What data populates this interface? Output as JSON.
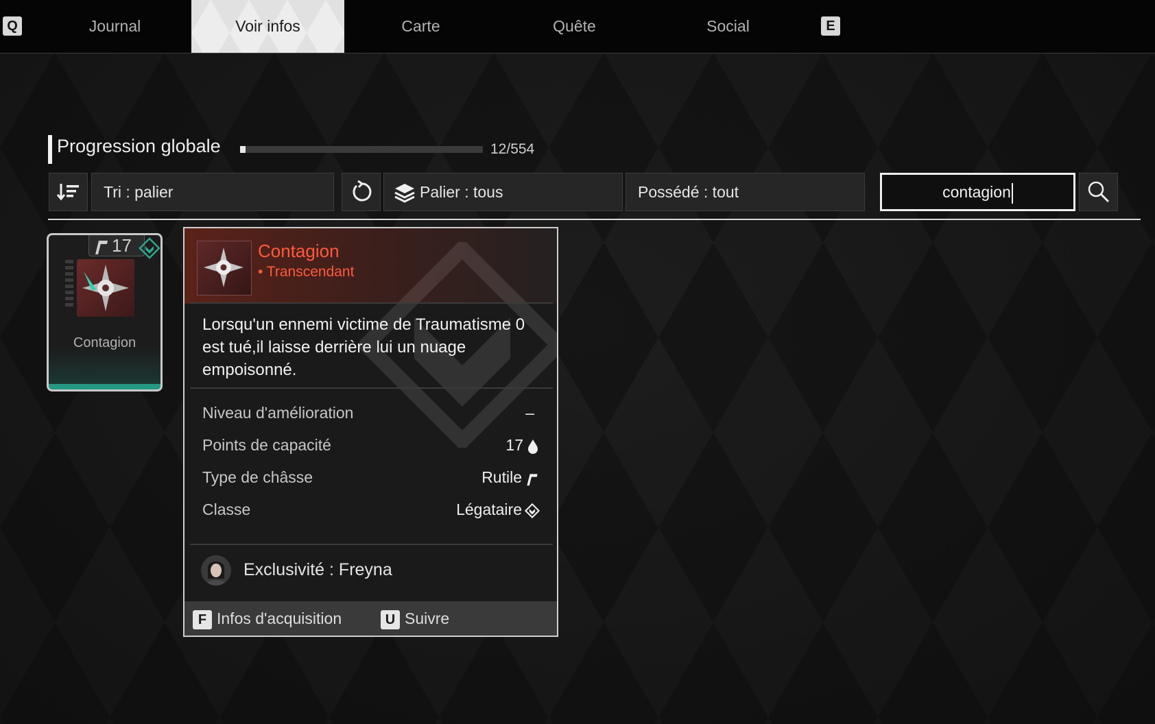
{
  "nav": {
    "key_left": "Q",
    "key_right": "E",
    "tabs": [
      {
        "label": "Journal"
      },
      {
        "label": "Voir infos",
        "active": true
      },
      {
        "label": "Carte"
      },
      {
        "label": "Quête"
      },
      {
        "label": "Social"
      }
    ]
  },
  "progress": {
    "title": "Progression globale",
    "count_text": "12/554",
    "fraction": 0.0217
  },
  "filters": {
    "sort_label": "Tri : palier",
    "tier_label": "Palier : tous",
    "owned_label": "Possédé : tout",
    "search_value": "contagion",
    "icons": [
      "sort-icon",
      "reset-icon",
      "layers-icon",
      "search-icon"
    ]
  },
  "module_card": {
    "capacity": "17",
    "label": "Contagion",
    "icons": [
      "rutile-socket-icon",
      "legataire-class-icon",
      "contagion-module-icon"
    ]
  },
  "tooltip": {
    "name": "Contagion",
    "tier": "• Transcendant",
    "description": "Lorsqu'un ennemi victime de Traumatisme 0 est tué,il laisse derrière lui un nuage empoisonné.",
    "rows": [
      {
        "label": "Niveau d'amélioration",
        "value": "–"
      },
      {
        "label": "Points de capacité",
        "value": "17"
      },
      {
        "label": "Type de châsse",
        "value": "Rutile"
      },
      {
        "label": "Classe",
        "value": "Légataire"
      }
    ],
    "exclusive": "Exclusivité : Freyna",
    "footer": [
      {
        "key": "F",
        "label": "Infos d'acquisition"
      },
      {
        "key": "U",
        "label": "Suivre"
      }
    ]
  },
  "colors": {
    "accent_red": "#ff5a3c",
    "teal": "#27b096",
    "highlight": "#ededed"
  }
}
